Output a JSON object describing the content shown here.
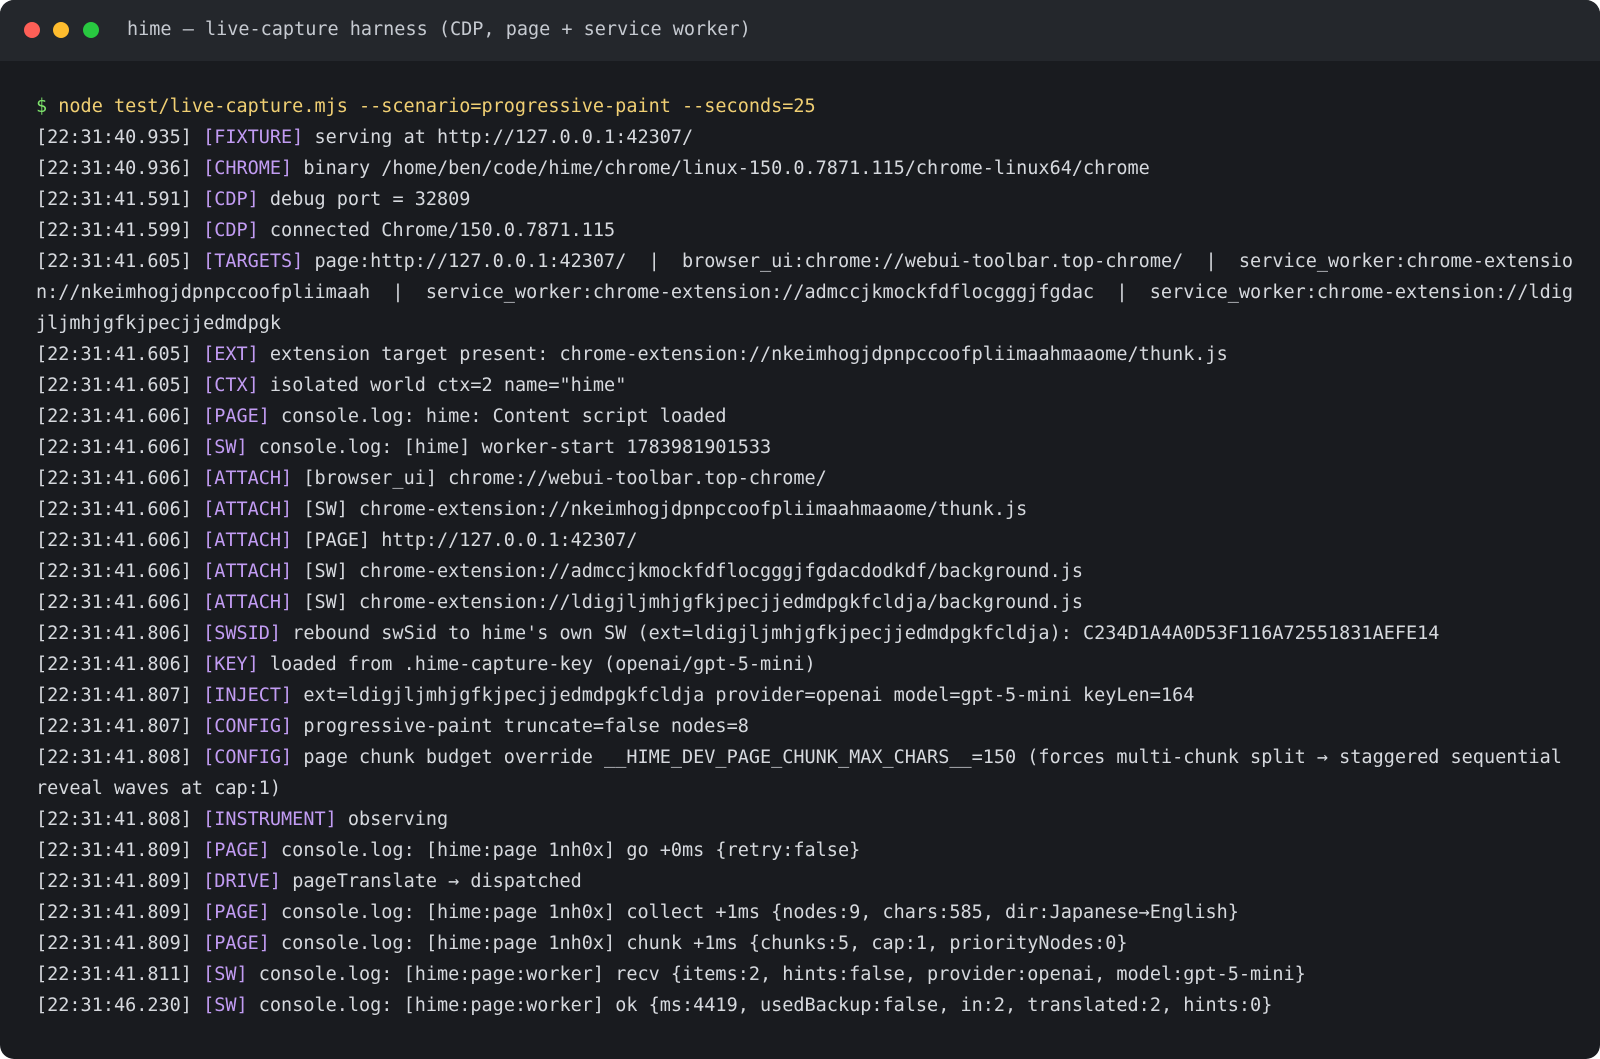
{
  "window": {
    "title": "hime — live-capture harness (CDP, page + service worker)",
    "colors": {
      "background": "#191b1f",
      "titlebar": "#24272c",
      "text": "#d6d9de",
      "tag": "#c29cf3",
      "prompt_symbol": "#7ee36c",
      "command": "#f0cf73",
      "close": "#fe5f57",
      "minimize": "#febc2e",
      "maximize": "#28c840"
    }
  },
  "terminal": {
    "prompt": {
      "symbol": "$",
      "command": "node test/live-capture.mjs --scenario=progressive-paint --seconds=25"
    },
    "lines": [
      {
        "ts": "[22:31:40.935]",
        "tag": "[FIXTURE]",
        "msg": "serving at http://127.0.0.1:42307/"
      },
      {
        "ts": "[22:31:40.936]",
        "tag": "[CHROME]",
        "msg": "binary /home/ben/code/hime/chrome/linux-150.0.7871.115/chrome-linux64/chrome"
      },
      {
        "ts": "[22:31:41.591]",
        "tag": "[CDP]",
        "msg": "debug port = 32809"
      },
      {
        "ts": "[22:31:41.599]",
        "tag": "[CDP]",
        "msg": "connected Chrome/150.0.7871.115"
      },
      {
        "ts": "[22:31:41.605]",
        "tag": "[TARGETS]",
        "msg": "page:http://127.0.0.1:42307/  |  browser_ui:chrome://webui-toolbar.top-chrome/  |  service_worker:chrome-extension://nkeimhogjdpnpccoofpliimaah  |  service_worker:chrome-extension://admccjkmockfdflocgggjfgdac  |  service_worker:chrome-extension://ldigjljmhjgfkjpecjjedmdpgk"
      },
      {
        "ts": "[22:31:41.605]",
        "tag": "[EXT]",
        "msg": "extension target present: chrome-extension://nkeimhogjdpnpccoofpliimaahmaaome/thunk.js"
      },
      {
        "ts": "[22:31:41.605]",
        "tag": "[CTX]",
        "msg": "isolated world ctx=2 name=\"hime\""
      },
      {
        "ts": "[22:31:41.606]",
        "tag": "[PAGE]",
        "msg": "console.log: hime: Content script loaded"
      },
      {
        "ts": "[22:31:41.606]",
        "tag": "[SW]",
        "msg": "console.log: [hime] worker-start 1783981901533"
      },
      {
        "ts": "[22:31:41.606]",
        "tag": "[ATTACH]",
        "msg": "[browser_ui] chrome://webui-toolbar.top-chrome/"
      },
      {
        "ts": "[22:31:41.606]",
        "tag": "[ATTACH]",
        "msg": "[SW] chrome-extension://nkeimhogjdpnpccoofpliimaahmaaome/thunk.js"
      },
      {
        "ts": "[22:31:41.606]",
        "tag": "[ATTACH]",
        "msg": "[PAGE] http://127.0.0.1:42307/"
      },
      {
        "ts": "[22:31:41.606]",
        "tag": "[ATTACH]",
        "msg": "[SW] chrome-extension://admccjkmockfdflocgggjfgdacdodkdf/background.js"
      },
      {
        "ts": "[22:31:41.606]",
        "tag": "[ATTACH]",
        "msg": "[SW] chrome-extension://ldigjljmhjgfkjpecjjedmdpgkfcldja/background.js"
      },
      {
        "ts": "[22:31:41.806]",
        "tag": "[SWSID]",
        "msg": "rebound swSid to hime's own SW (ext=ldigjljmhjgfkjpecjjedmdpgkfcldja): C234D1A4A0D53F116A72551831AEFE14"
      },
      {
        "ts": "[22:31:41.806]",
        "tag": "[KEY]",
        "msg": "loaded from .hime-capture-key (openai/gpt-5-mini)"
      },
      {
        "ts": "[22:31:41.807]",
        "tag": "[INJECT]",
        "msg": "ext=ldigjljmhjgfkjpecjjedmdpgkfcldja provider=openai model=gpt-5-mini keyLen=164"
      },
      {
        "ts": "[22:31:41.807]",
        "tag": "[CONFIG]",
        "msg": "progressive-paint truncate=false nodes=8"
      },
      {
        "ts": "[22:31:41.808]",
        "tag": "[CONFIG]",
        "msg": "page chunk budget override __HIME_DEV_PAGE_CHUNK_MAX_CHARS__=150 (forces multi-chunk split → staggered sequential reveal waves at cap:1)"
      },
      {
        "ts": "[22:31:41.808]",
        "tag": "[INSTRUMENT]",
        "msg": "observing"
      },
      {
        "ts": "[22:31:41.809]",
        "tag": "[PAGE]",
        "msg": "console.log: [hime:page 1nh0x] go +0ms {retry:false}"
      },
      {
        "ts": "[22:31:41.809]",
        "tag": "[DRIVE]",
        "msg": "pageTranslate → dispatched"
      },
      {
        "ts": "[22:31:41.809]",
        "tag": "[PAGE]",
        "msg": "console.log: [hime:page 1nh0x] collect +1ms {nodes:9, chars:585, dir:Japanese→English}"
      },
      {
        "ts": "[22:31:41.809]",
        "tag": "[PAGE]",
        "msg": "console.log: [hime:page 1nh0x] chunk +1ms {chunks:5, cap:1, priorityNodes:0}"
      },
      {
        "ts": "[22:31:41.811]",
        "tag": "[SW]",
        "msg": "console.log: [hime:page:worker] recv {items:2, hints:false, provider:openai, model:gpt-5-mini}"
      },
      {
        "ts": "[22:31:46.230]",
        "tag": "[SW]",
        "msg": "console.log: [hime:page:worker] ok {ms:4419, usedBackup:false, in:2, translated:2, hints:0}"
      }
    ]
  }
}
